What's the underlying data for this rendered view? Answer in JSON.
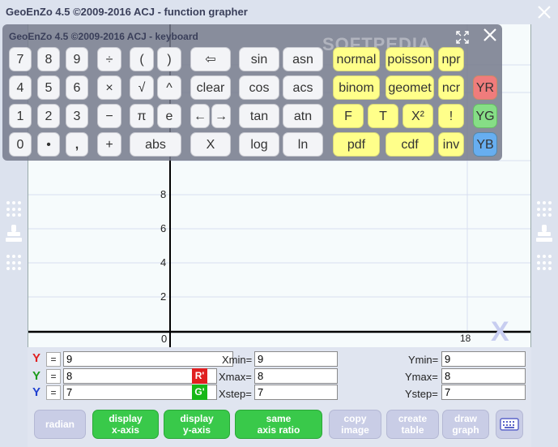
{
  "window": {
    "title": "GeoEnZo 4.5 ©2009-2016 ACJ - function grapher"
  },
  "keyboard": {
    "title": "GeoEnZo 4.5 ©2009-2016 ACJ - keyboard"
  },
  "keys": {
    "row1": [
      "7",
      "8",
      "9",
      "÷",
      "(",
      ")",
      "⇦",
      "sin",
      "asn",
      "normal",
      "poisson",
      "npr"
    ],
    "row2": [
      "4",
      "5",
      "6",
      "×",
      "√",
      "^",
      "clear",
      "cos",
      "acs",
      "binom",
      "geomet",
      "ncr",
      "YR"
    ],
    "row3": [
      "1",
      "2",
      "3",
      "−",
      "π",
      "e",
      "←",
      "→",
      "tan",
      "atn",
      "F",
      "T",
      "X²",
      "!",
      "YG"
    ],
    "row4": [
      "0",
      "•",
      ",",
      "+",
      "abs",
      "X",
      "log",
      "ln",
      "pdf",
      "cdf",
      "inv",
      "YB"
    ]
  },
  "graph": {
    "y_ticks": [
      "8",
      "6",
      "4",
      "2",
      "0"
    ],
    "x_tick": "18",
    "axis_label": "X",
    "watermark": "SOFTPEDIA"
  },
  "form": {
    "y_labels": [
      "Y",
      "Y",
      "Y"
    ],
    "y_colors": [
      "#e02020",
      "#1a9a1a",
      "#2040d0"
    ],
    "eq": "=",
    "y_values": [
      "9",
      "8",
      "7"
    ],
    "badges": [
      "R'",
      "G'"
    ],
    "x_labels": [
      "Xmin=",
      "Xmax=",
      "Xstep="
    ],
    "x_values": [
      "9",
      "8",
      "7"
    ],
    "ylim_labels": [
      "Ymin=",
      "Ymax=",
      "Ystep="
    ],
    "ylim_values": [
      "9",
      "8",
      "7"
    ]
  },
  "buttons": {
    "radian": "radian",
    "display_x_1": "display",
    "display_x_2": "x-axis",
    "display_y_1": "display",
    "display_y_2": "y-axis",
    "same_1": "same",
    "same_2": "axis ratio",
    "copy_1": "copy",
    "copy_2": "image",
    "create_1": "create",
    "create_2": "table",
    "draw_1": "draw",
    "draw_2": "graph"
  }
}
